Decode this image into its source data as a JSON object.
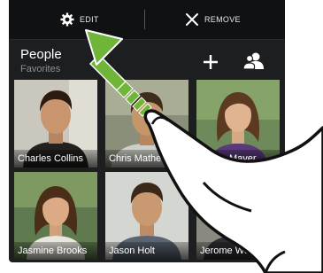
{
  "edit_bar": {
    "edit_label": "EDIT",
    "remove_label": "REMOVE"
  },
  "header": {
    "title": "People",
    "subtitle": "Favorites"
  },
  "contacts": [
    {
      "name": "Charles Collins"
    },
    {
      "name": "Chris Mathew"
    },
    {
      "name": "Grace Mayer"
    },
    {
      "name": "Jasmine Brooks"
    },
    {
      "name": "Jason Holt"
    },
    {
      "name": "Jerome Wong"
    }
  ],
  "gesture": {
    "arrow_color": "#6fb537",
    "description_icon": "drag-up-gesture-icon"
  }
}
